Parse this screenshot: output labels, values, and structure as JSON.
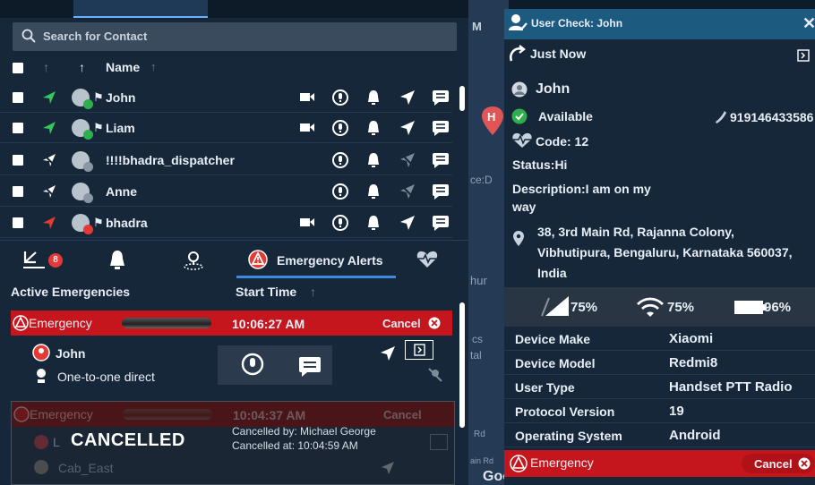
{
  "left": {
    "search": {
      "placeholder": "Search for Contact"
    },
    "header": {
      "name_label": "Name"
    },
    "contacts": [
      {
        "name": "John",
        "status": "available"
      },
      {
        "name": "Liam",
        "status": "available"
      },
      {
        "name": "!!!!bhadra_dispatcher",
        "status": "offline"
      },
      {
        "name": "Anne",
        "status": "offline"
      },
      {
        "name": "bhadra",
        "status": "busy"
      }
    ],
    "tabs": {
      "missed_badge": "8",
      "emergency_label": "Emergency Alerts"
    },
    "emergencies": {
      "header_active": "Active Emergencies",
      "header_start": "Start Time",
      "active": {
        "title": "Emergency",
        "time": "10:06:27 AM",
        "cancel_label": "Cancel",
        "user": "John",
        "call_type": "One-to-one direct"
      },
      "cancelled": {
        "title": "Emergency",
        "time": "10:04:37 AM",
        "cancel_label": "Cancel",
        "status": "CANCELLED",
        "by": "Cancelled by: Michael George",
        "at": "Cancelled at: 10:04:59 AM",
        "user_partial": "L",
        "call_type": "Cab_East"
      }
    }
  },
  "map": {
    "label_m": "M",
    "label_ce": "ce:D",
    "label_hur": "hur",
    "label_cs": "cs",
    "label_tal": "tal",
    "label_rd": "Rd",
    "label_ainrd": "ain Rd",
    "google": "Google"
  },
  "panel": {
    "title": "User Check: John",
    "time_ago": "Just Now",
    "user_name": "John",
    "availability": "Available",
    "phone": "919146433586",
    "code": "Code: 12",
    "status": "Status:Hi",
    "description": "Description:I am on my way",
    "address": "38, 3rd Main Rd, Rajanna Colony, Vibhutipura, Bengaluru, Karnataka 560037, India",
    "stats": {
      "signal": "75%",
      "wifi": "75%",
      "battery": "96%"
    },
    "device": [
      {
        "key": "Device Make",
        "value": "Xiaomi"
      },
      {
        "key": "Device Model",
        "value": "Redmi8"
      },
      {
        "key": "User Type",
        "value": "Handset PTT Radio"
      },
      {
        "key": "Protocol Version",
        "value": "19"
      },
      {
        "key": "Operating System",
        "value": "Android"
      }
    ],
    "emergency_label": "Emergency",
    "cancel_label": "Cancel"
  }
}
